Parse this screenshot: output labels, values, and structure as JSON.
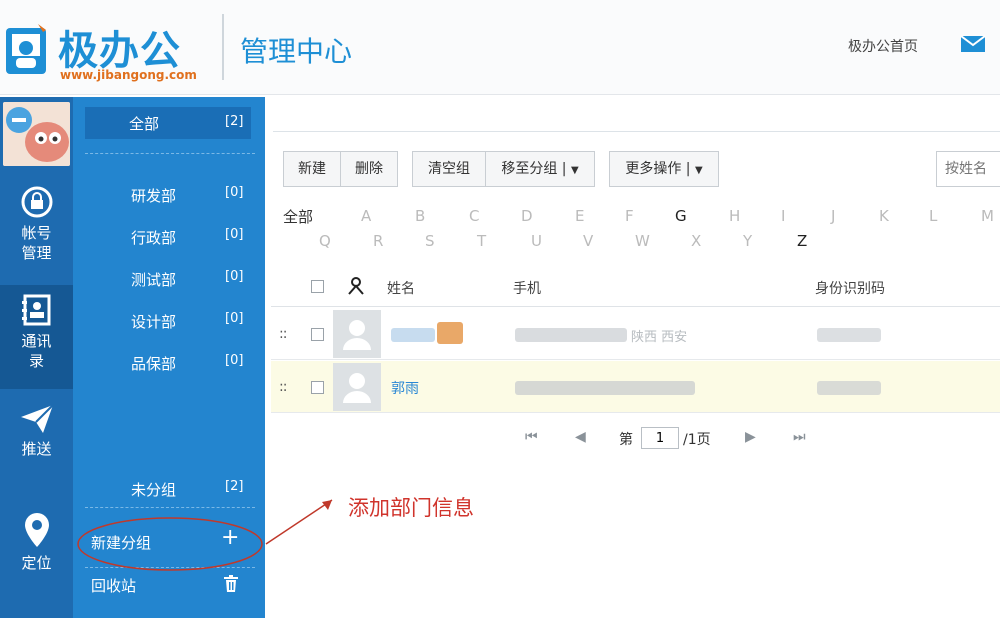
{
  "header": {
    "logo_text": "极办公",
    "logo_url": "www.jibangong.com",
    "title": "管理中心",
    "home_link": "极办公首页"
  },
  "iconnav": {
    "items": [
      {
        "label_line1": "帐号",
        "label_line2": "管理",
        "icon": "lock-refresh-icon"
      },
      {
        "label_line1": "通讯",
        "label_line2": "录",
        "icon": "contacts-book-icon"
      },
      {
        "label_line1": "推送",
        "label_line2": "",
        "icon": "paper-plane-icon"
      },
      {
        "label_line1": "定位",
        "label_line2": "",
        "icon": "location-pin-icon"
      }
    ]
  },
  "groups": {
    "all": {
      "name": "全部",
      "count": "[2]"
    },
    "items": [
      {
        "name": "研发部",
        "count": "[0]"
      },
      {
        "name": "行政部",
        "count": "[0]"
      },
      {
        "name": "测试部",
        "count": "[0]"
      },
      {
        "name": "设计部",
        "count": "[0]"
      },
      {
        "name": "品保部",
        "count": "[0]"
      }
    ],
    "ungrouped": {
      "name": "未分组",
      "count": "[2]"
    },
    "new_group": "新建分组",
    "new_group_plus": "+",
    "recycle": "回收站"
  },
  "toolbar": {
    "new": "新建",
    "delete": "删除",
    "clear_group": "清空组",
    "move_group": "移至分组 |",
    "more": "更多操作 |",
    "search_placeholder": "按姓名"
  },
  "letters": {
    "all": "全部",
    "row1": [
      "A",
      "B",
      "C",
      "D",
      "E",
      "F",
      "G",
      "H",
      "I",
      "J",
      "K",
      "L",
      "M"
    ],
    "row2": [
      "Q",
      "R",
      "S",
      "T",
      "U",
      "V",
      "W",
      "X",
      "Y",
      "Z"
    ]
  },
  "table": {
    "col_name": "姓名",
    "col_phone": "手机",
    "col_id": "身份识别码",
    "rows": [
      {
        "location": "陕西 西安"
      },
      {
        "name": "郭雨"
      }
    ]
  },
  "pager": {
    "prefix": "第",
    "page": "1",
    "suffix": "/1页"
  },
  "annotation": "添加部门信息"
}
